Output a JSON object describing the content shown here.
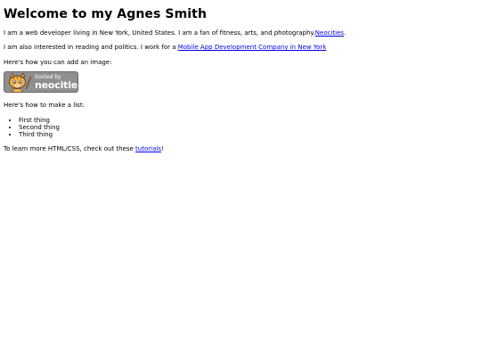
{
  "title": "Welcome to my Agnes Smith",
  "intro": {
    "text": "I am a web developer living in New York, United States. I am a fan of fitness, arts, and photography.",
    "link_label": "Neocities",
    "suffix": "."
  },
  "work": {
    "text": "I am also interested in reading and politics. I work for a ",
    "link_label": "Mobile App Development Company in New York"
  },
  "image_section": {
    "label": "Here's how you can add an image:",
    "badge": {
      "hosted_text": "hosted by",
      "brand_text": "neocities",
      "icon": "neocities-cat-logo"
    }
  },
  "list_section": {
    "label": "Here's how to make a list:",
    "items": [
      "First thing",
      "Second thing",
      "Third thing"
    ]
  },
  "footer": {
    "text": "To learn more HTML/CSS, check out these ",
    "link_label": "tutorials",
    "suffix": "!"
  },
  "colors": {
    "link": "#0000ee",
    "badge_bg": "#8f8f8f",
    "text": "#000000"
  }
}
